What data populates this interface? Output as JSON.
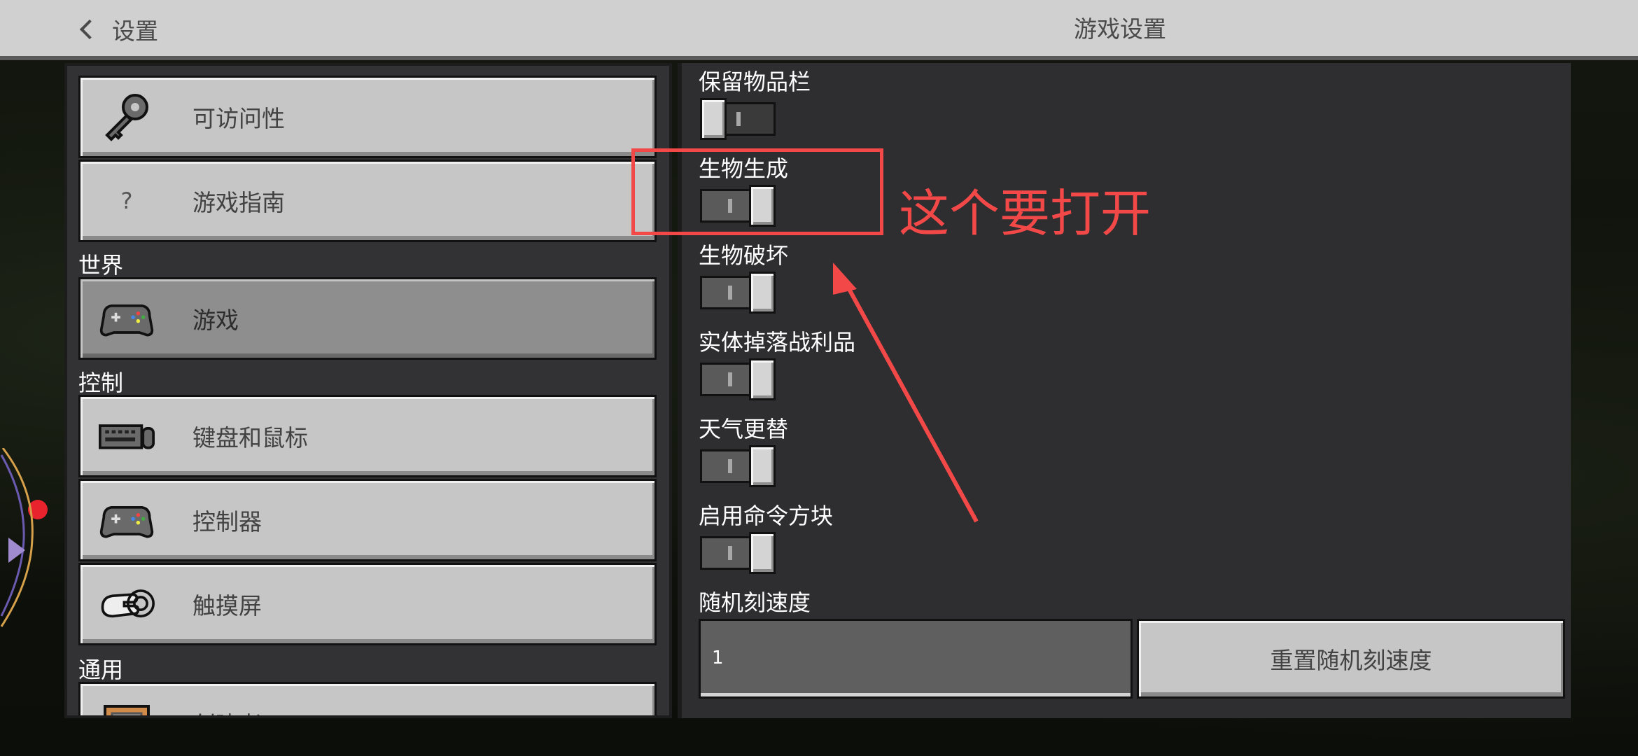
{
  "header": {
    "back_label": "设置",
    "title": "游戏设置"
  },
  "sidebar": {
    "items": [
      {
        "label": "可访问性",
        "icon": "key-icon"
      },
      {
        "label": "游戏指南",
        "icon": "question-icon",
        "icon_glyph": "?"
      },
      {
        "label": "游戏",
        "icon": "controller-icon",
        "selected": true
      },
      {
        "label": "键盘和鼠标",
        "icon": "keyboard-mouse-icon"
      },
      {
        "label": "控制器",
        "icon": "controller-icon"
      },
      {
        "label": "触摸屏",
        "icon": "touch-hand-icon"
      },
      {
        "label": "创建者",
        "icon": "creator-icon"
      }
    ],
    "sections": {
      "world": "世界",
      "controls": "控制",
      "general": "通用"
    }
  },
  "settings": {
    "options": [
      {
        "label": "保留物品栏",
        "state": "off"
      },
      {
        "label": "生物生成",
        "state": "on"
      },
      {
        "label": "生物破坏",
        "state": "on"
      },
      {
        "label": "实体掉落战利品",
        "state": "on"
      },
      {
        "label": "天气更替",
        "state": "on"
      },
      {
        "label": "启用命令方块",
        "state": "on"
      }
    ],
    "random_tick": {
      "label": "随机刻速度",
      "value": "1",
      "reset_label": "重置随机刻速度"
    }
  },
  "annotation": {
    "text": "这个要打开",
    "color": "#f24848"
  },
  "colors": {
    "panel": "#2e2e30",
    "button": "#c6c6c6",
    "selected_button": "#8e8e8e",
    "top_bar": "#d0d0d0"
  }
}
